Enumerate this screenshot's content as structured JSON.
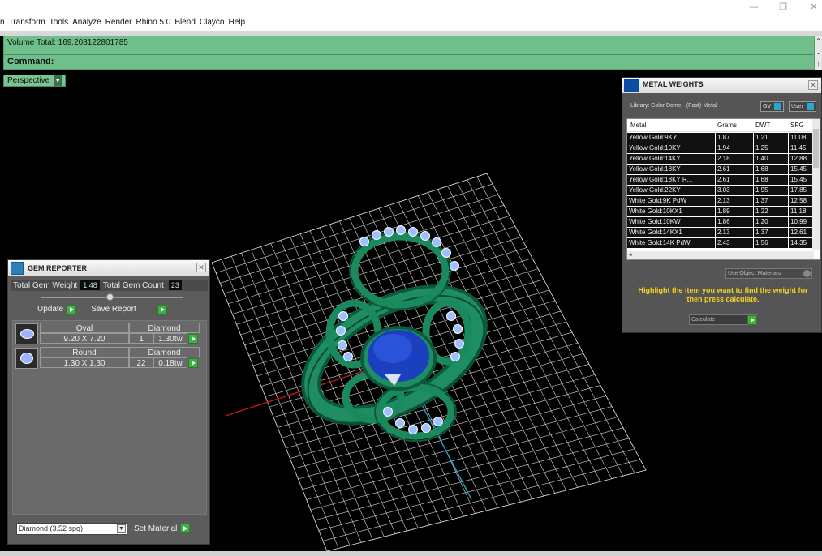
{
  "menu": {
    "items": [
      "n",
      "Transform",
      "Tools",
      "Analyze",
      "Render",
      "Rhino 5.0",
      "Blend",
      "Clayco",
      "Help"
    ]
  },
  "window_controls": {
    "minimize": "—",
    "restore": "❐",
    "close": "✕"
  },
  "command": {
    "history_line": "Volume Total: 169.208122801785",
    "prompt_label": "Command:"
  },
  "viewport": {
    "name": "Perspective"
  },
  "gem_reporter": {
    "title": "GEM REPORTER",
    "total_weight_label": "Total Gem Weight",
    "total_weight_value": "1.48",
    "total_count_label": "Total Gem Count",
    "total_count_value": "23",
    "update_label": "Update",
    "save_report_label": "Save Report",
    "gems": [
      {
        "shape": "Oval",
        "size": "9.20 X 7.20",
        "type": "Diamond",
        "count": "1",
        "weight": "1.30tw"
      },
      {
        "shape": "Round",
        "size": "1.30 X 1.30",
        "type": "Diamond",
        "count": "22",
        "weight": "0.18tw"
      }
    ],
    "material_select": "Diamond     (3.52 spg)",
    "set_material_label": "Set Material"
  },
  "metal_weights": {
    "title": "METAL WEIGHTS",
    "library_label": "Library: Color Dome - (Fast)-Metal",
    "gv_label": "GV",
    "user_label": "User",
    "columns": [
      "Metal",
      "Grams",
      "DWT",
      "SPG"
    ],
    "rows": [
      [
        "Yellow Gold:9KY",
        "1.87",
        "1.21",
        "11.08"
      ],
      [
        "Yellow Gold:10KY",
        "1.94",
        "1.25",
        "11.45"
      ],
      [
        "Yellow Gold:14KY",
        "2.18",
        "1.40",
        "12.88"
      ],
      [
        "Yellow Gold:18KY",
        "2.61",
        "1.68",
        "15.45"
      ],
      [
        "Yellow Gold:18KY R...",
        "2.61",
        "1.68",
        "15.45"
      ],
      [
        "Yellow Gold:22KY",
        "3.03",
        "1.95",
        "17.85"
      ],
      [
        "White Gold:9K PdW",
        "2.13",
        "1.37",
        "12.58"
      ],
      [
        "White Gold:10KX1",
        "1.89",
        "1.22",
        "11.18"
      ],
      [
        "White Gold:10KW",
        "1.86",
        "1.20",
        "10.99"
      ],
      [
        "White Gold:14KX1",
        "2.13",
        "1.37",
        "12.61"
      ],
      [
        "White Gold:14K PdW",
        "2.43",
        "1.56",
        "14.35"
      ]
    ],
    "use_object_materials": "Use Object Materials",
    "highlight_text": "Highlight the item you want to find the weight for then press calculate.",
    "calculate_label": "Calculate"
  }
}
